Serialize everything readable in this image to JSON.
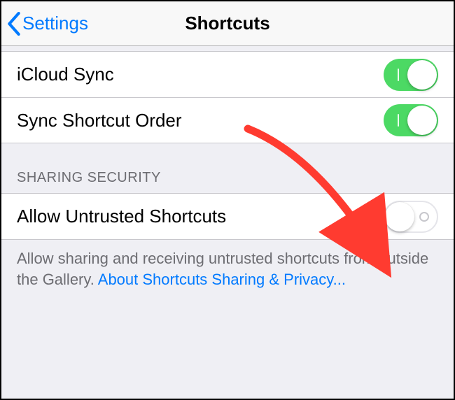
{
  "nav": {
    "back_label": "Settings",
    "title": "Shortcuts"
  },
  "group1": {
    "items": [
      {
        "label": "iCloud Sync",
        "on": true
      },
      {
        "label": "Sync Shortcut Order",
        "on": true
      }
    ]
  },
  "section": {
    "header": "SHARING SECURITY",
    "items": [
      {
        "label": "Allow Untrusted Shortcuts",
        "on": false
      }
    ],
    "footer_text": "Allow sharing and receiving untrusted shortcuts from outside the Gallery. ",
    "footer_link": "About Shortcuts Sharing & Privacy..."
  },
  "colors": {
    "tint": "#007aff",
    "switch_on": "#4cd964",
    "annotation": "#ff3b30"
  }
}
